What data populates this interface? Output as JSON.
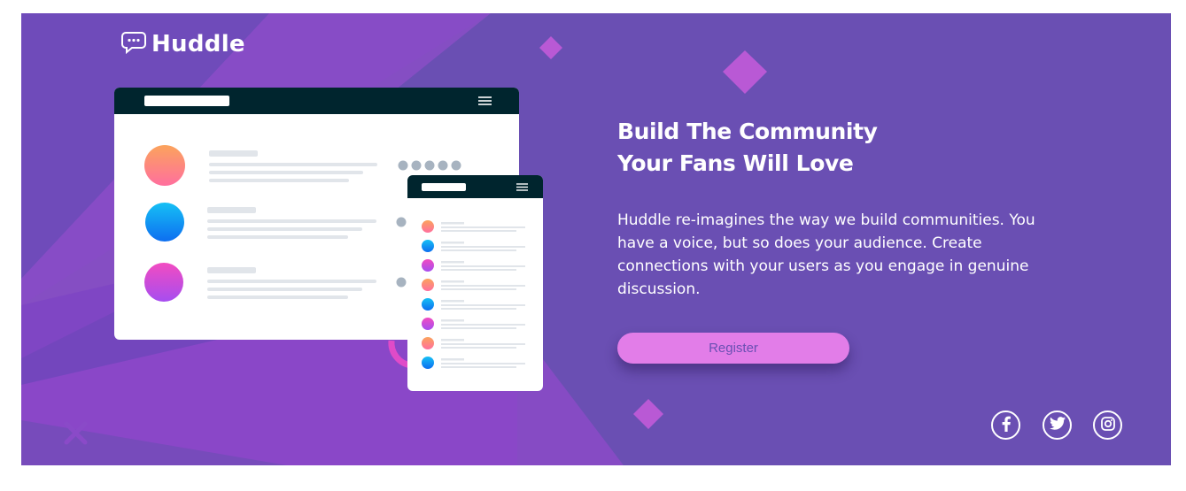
{
  "brand": {
    "name": "Huddle",
    "logo_icon": "chat-bubble-icon"
  },
  "hero": {
    "headline_line1": "Build The Community",
    "headline_line2": "Your Fans Will Love",
    "description": "Huddle re-imagines the way we build communities. You have a voice, but so does your audience. Create connections with your users as you engage in genuine discussion.",
    "register_label": "Register"
  },
  "social": [
    {
      "name": "facebook",
      "icon": "facebook-icon"
    },
    {
      "name": "twitter",
      "icon": "twitter-icon"
    },
    {
      "name": "instagram",
      "icon": "instagram-icon"
    }
  ],
  "colors": {
    "background": "#6a4fb3",
    "accent": "#e27de8",
    "mock_header": "#00252e",
    "white": "#ffffff"
  }
}
